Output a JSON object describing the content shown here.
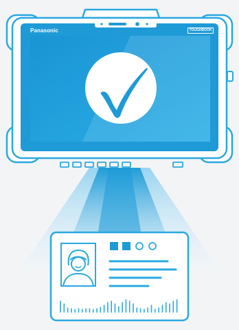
{
  "device": {
    "brand": "Panasonic",
    "model_badge": "TOUGHBOOK"
  },
  "screen": {
    "status_icon": "checkmark-icon"
  },
  "card": {
    "icons": [
      "photo-avatar-icon",
      "square-indicator",
      "square-indicator",
      "circle-indicator",
      "circle-indicator"
    ]
  },
  "colors": {
    "accent": "#29a8e0",
    "screen": "#1f9ad8",
    "line": "#1e9ad7",
    "background": "#f3f4f6"
  }
}
